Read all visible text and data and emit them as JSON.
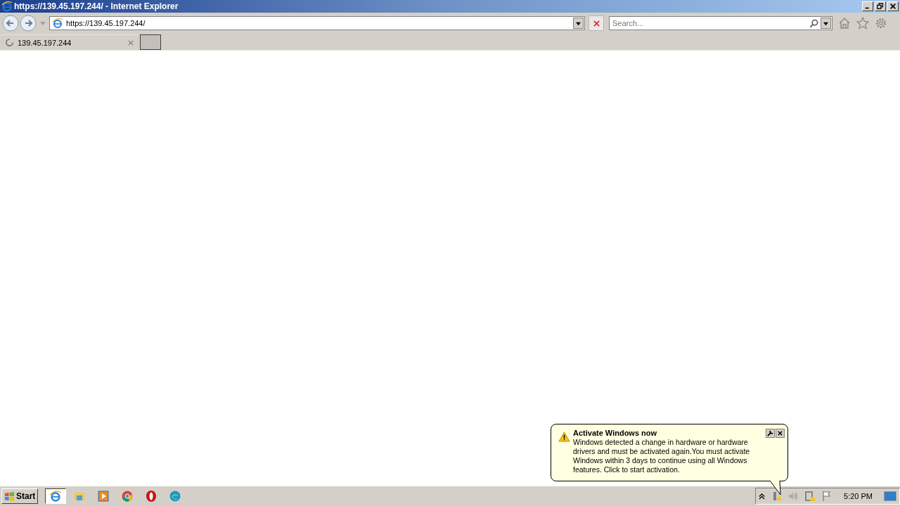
{
  "window": {
    "title": "https://139.45.197.244/ - Internet Explorer"
  },
  "address": {
    "value": "https://139.45.197.244/"
  },
  "search": {
    "placeholder": "Search..."
  },
  "tabs": [
    {
      "label": "139.45.197.244",
      "selected": true
    }
  ],
  "notification": {
    "title": "Activate Windows now",
    "body": "Windows detected a change in hardware or hardware drivers and must be activated again.You must activate Windows within 3 days to continue using all Windows features. Click to start activation."
  },
  "taskbar": {
    "start": "Start",
    "apps": [
      {
        "kind": "ie",
        "selected": true
      },
      {
        "kind": "folder",
        "selected": false
      },
      {
        "kind": "media",
        "selected": false
      },
      {
        "kind": "chrome",
        "selected": false
      },
      {
        "kind": "opera",
        "selected": false
      },
      {
        "kind": "edge",
        "selected": false
      }
    ],
    "clock": "5:20 PM"
  }
}
